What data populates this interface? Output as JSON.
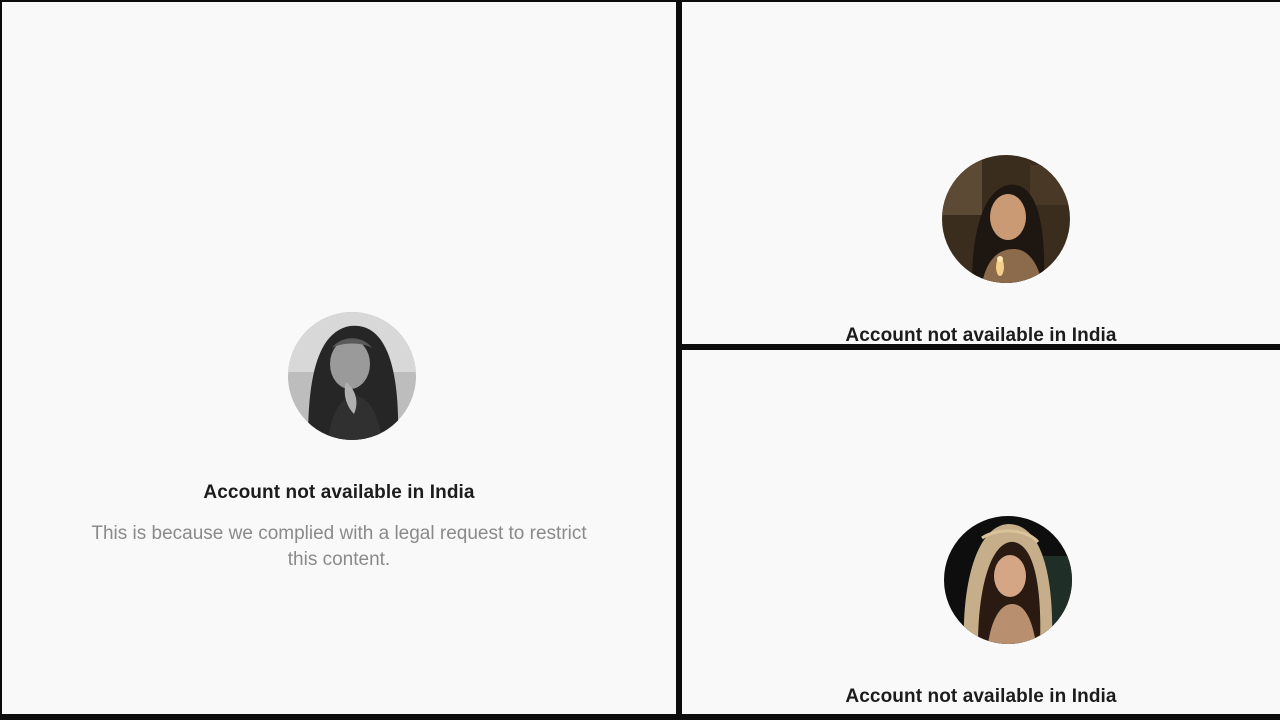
{
  "panels": {
    "left": {
      "title": "Account not available in India",
      "message": "This is because we complied with a legal request to restrict this content."
    },
    "top_right": {
      "title": "Account not available in India"
    },
    "bottom_right": {
      "title": "Account not available in India"
    }
  },
  "colors": {
    "panel_background": "#f9f9f9",
    "divider": "#0c0c0c",
    "title_text": "#1c1c1c",
    "message_text": "#8a8a8a"
  }
}
